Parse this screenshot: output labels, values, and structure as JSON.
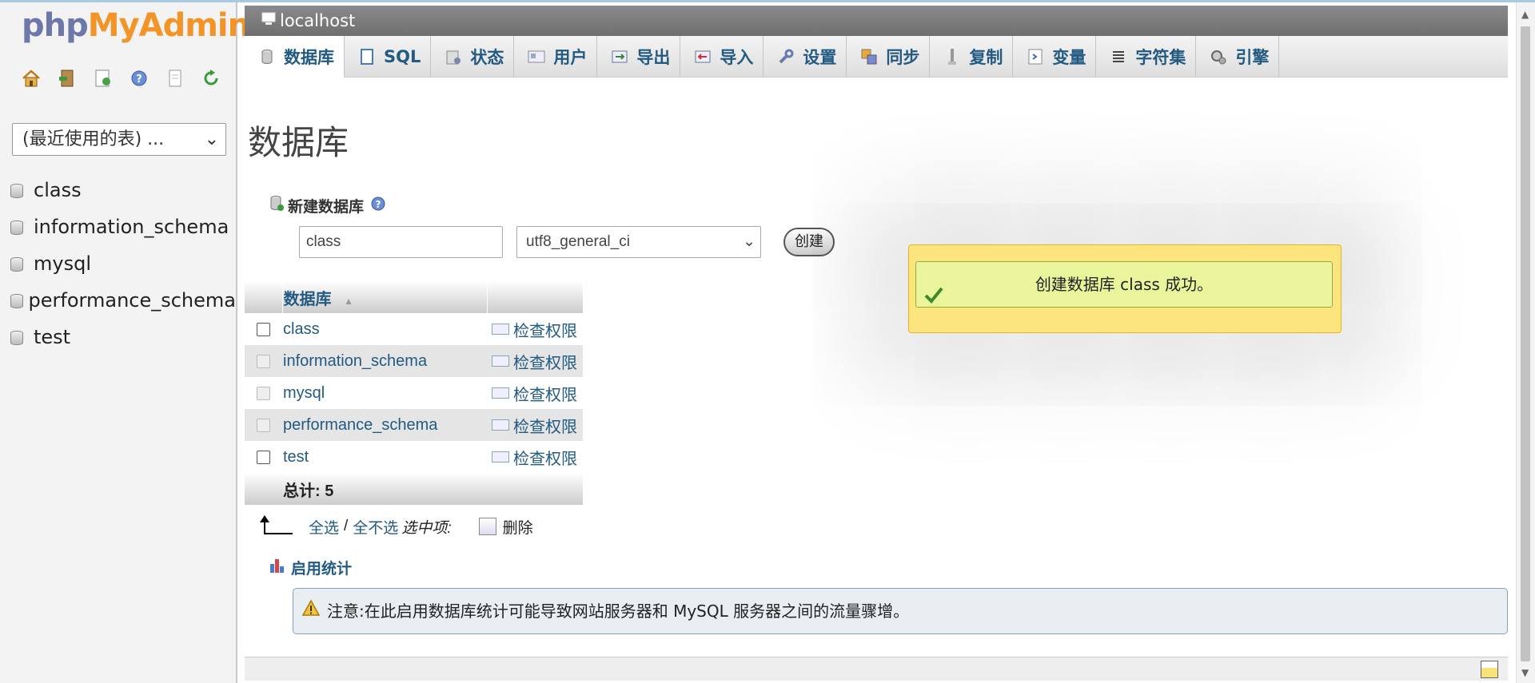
{
  "sidebar": {
    "logo_part1": "php",
    "logo_part2": "MyAdmin",
    "quick_icons": [
      "home-icon",
      "exit-icon",
      "sql-query-icon",
      "help-icon",
      "docs-icon",
      "reload-icon"
    ],
    "recent_select": "(最近使用的表) ...",
    "databases": [
      "class",
      "information_schema",
      "mysql",
      "performance_schema",
      "test"
    ]
  },
  "topbar": {
    "server": "localhost"
  },
  "tabs": [
    {
      "label": "数据库",
      "icon": "database-icon",
      "active": true
    },
    {
      "label": "SQL",
      "icon": "sql-icon"
    },
    {
      "label": "状态",
      "icon": "status-icon"
    },
    {
      "label": "用户",
      "icon": "users-icon"
    },
    {
      "label": "导出",
      "icon": "export-icon"
    },
    {
      "label": "导入",
      "icon": "import-icon"
    },
    {
      "label": "设置",
      "icon": "settings-icon"
    },
    {
      "label": "同步",
      "icon": "sync-icon"
    },
    {
      "label": "复制",
      "icon": "replication-icon"
    },
    {
      "label": "变量",
      "icon": "variables-icon"
    },
    {
      "label": "字符集",
      "icon": "charset-icon"
    },
    {
      "label": "引擎",
      "icon": "engines-icon"
    }
  ],
  "page_title": "数据库",
  "create_db": {
    "label": "新建数据库",
    "name_value": "class",
    "collation": "utf8_general_ci",
    "button": "创建"
  },
  "db_table": {
    "header": "数据库",
    "rows": [
      {
        "name": "class",
        "priv": "检查权限"
      },
      {
        "name": "information_schema",
        "priv": "检查权限"
      },
      {
        "name": "mysql",
        "priv": "检查权限"
      },
      {
        "name": "performance_schema",
        "priv": "检查权限"
      },
      {
        "name": "test",
        "priv": "检查权限"
      }
    ],
    "total": "总计: 5"
  },
  "bulk": {
    "select_all": "全选",
    "separator": "/",
    "deselect_all": "全不选",
    "with_selected": "选中项:",
    "delete": "删除"
  },
  "stats": {
    "label": "启用统计"
  },
  "notice": {
    "text": "注意:在此启用数据库统计可能导致网站服务器和 MySQL 服务器之间的流量骤增。"
  },
  "popup": {
    "message": "创建数据库 class 成功。"
  },
  "colors": {
    "accent": "#235a81",
    "popup_bg": "#fce57e",
    "success_bg": "#eaf59b"
  }
}
